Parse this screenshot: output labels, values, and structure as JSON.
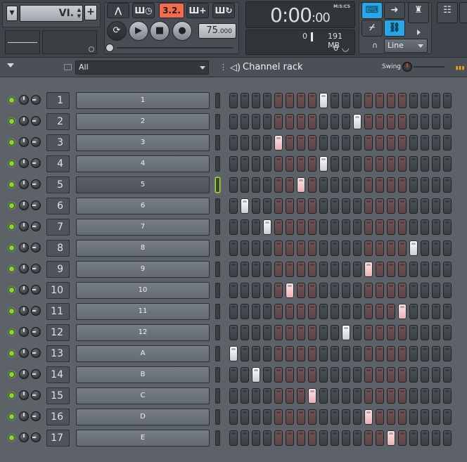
{
  "toolbar": {
    "pattern_name": "VI.",
    "add_label": "+",
    "tempo_int": "75",
    "tempo_frac": ".000",
    "time_main": "0:00",
    "time_sub": "00",
    "time_label": "M:S:CS",
    "cpu_value": "0",
    "memory": "191 MB",
    "poly_value": "0",
    "snap_mode": "Line"
  },
  "rack_header": {
    "filter": "All",
    "title": "Channel rack",
    "swing_label": "Swing"
  },
  "channels": [
    {
      "num": "1",
      "name": "1",
      "steps": [
        8
      ]
    },
    {
      "num": "2",
      "name": "2",
      "steps": [
        11
      ]
    },
    {
      "num": "3",
      "name": "3",
      "steps": [
        4
      ]
    },
    {
      "num": "4",
      "name": "4",
      "steps": [
        8
      ]
    },
    {
      "num": "5",
      "name": "5",
      "steps": [
        6
      ]
    },
    {
      "num": "6",
      "name": "6",
      "steps": [
        1
      ]
    },
    {
      "num": "7",
      "name": "7",
      "steps": [
        3
      ]
    },
    {
      "num": "8",
      "name": "8",
      "steps": [
        16
      ]
    },
    {
      "num": "9",
      "name": "9",
      "steps": [
        12
      ]
    },
    {
      "num": "10",
      "name": "10",
      "steps": [
        5
      ]
    },
    {
      "num": "11",
      "name": "11",
      "steps": [
        15
      ]
    },
    {
      "num": "12",
      "name": "12",
      "steps": [
        10
      ]
    },
    {
      "num": "13",
      "name": "A",
      "steps": [
        0
      ]
    },
    {
      "num": "14",
      "name": "B",
      "steps": [
        2
      ]
    },
    {
      "num": "15",
      "name": "C",
      "steps": [
        7
      ]
    },
    {
      "num": "16",
      "name": "D",
      "steps": [
        12
      ]
    },
    {
      "num": "17",
      "name": "E",
      "steps": [
        14
      ]
    }
  ],
  "selected_channel": 4,
  "steps_per_pattern": 20
}
